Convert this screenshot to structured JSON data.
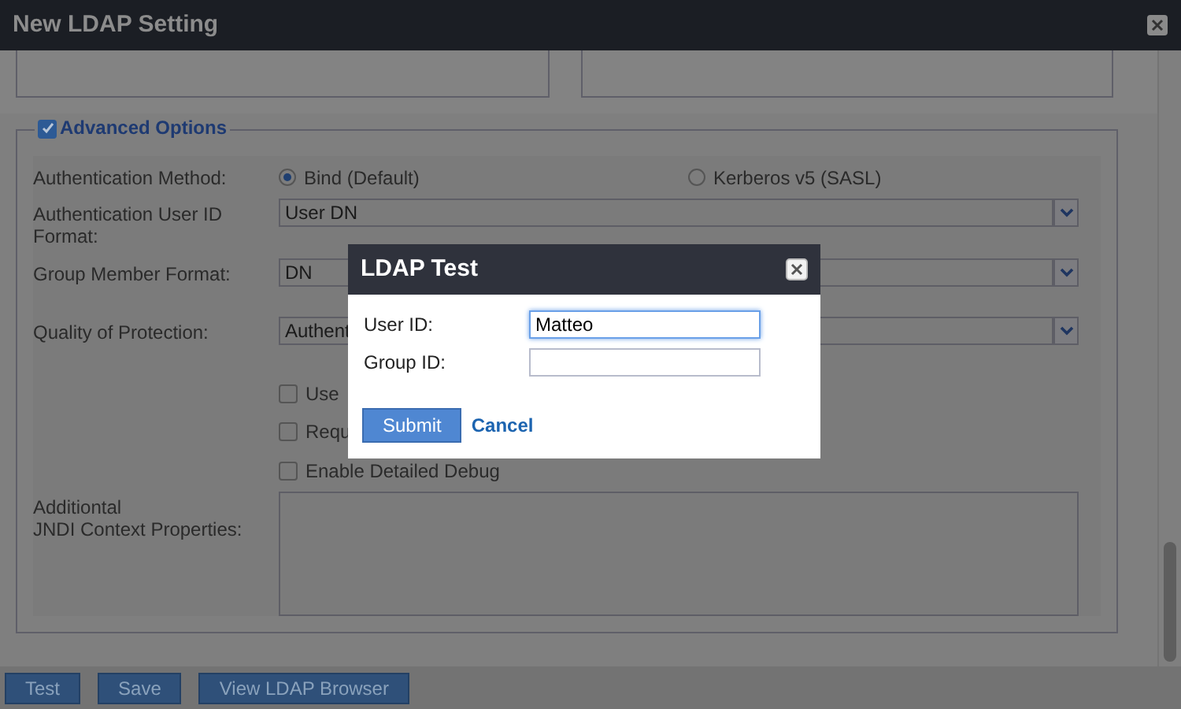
{
  "window": {
    "title": "New LDAP Setting"
  },
  "advanced_options": {
    "label": "Advanced Options",
    "checked": true,
    "authentication_method": {
      "label": "Authentication Method:",
      "options": [
        {
          "label": "Bind (Default)",
          "selected": true
        },
        {
          "label": "Kerberos v5 (SASL)",
          "selected": false
        }
      ]
    },
    "selects": [
      {
        "label": "Authentication User ID Format:",
        "value": "User DN"
      },
      {
        "label": "Group Member Format:",
        "value": "DN"
      },
      {
        "label": "Quality of Protection:",
        "value": "Authent"
      }
    ],
    "checkboxes": [
      {
        "label": "Use",
        "checked": false
      },
      {
        "label": "Requ",
        "checked": false
      },
      {
        "label": "Enable Detailed Debug",
        "checked": false
      }
    ],
    "jndi": {
      "label_lines": [
        "Additiontal",
        "JNDI Context Properties:"
      ]
    }
  },
  "footer_buttons": [
    "Test",
    "Save",
    "View LDAP Browser"
  ],
  "dialog": {
    "title": "LDAP Test",
    "fields": [
      {
        "label": "User ID:",
        "value": "Matteo",
        "focused": true
      },
      {
        "label": "Group ID:",
        "focused": false
      }
    ],
    "submit": "Submit",
    "cancel": "Cancel"
  }
}
